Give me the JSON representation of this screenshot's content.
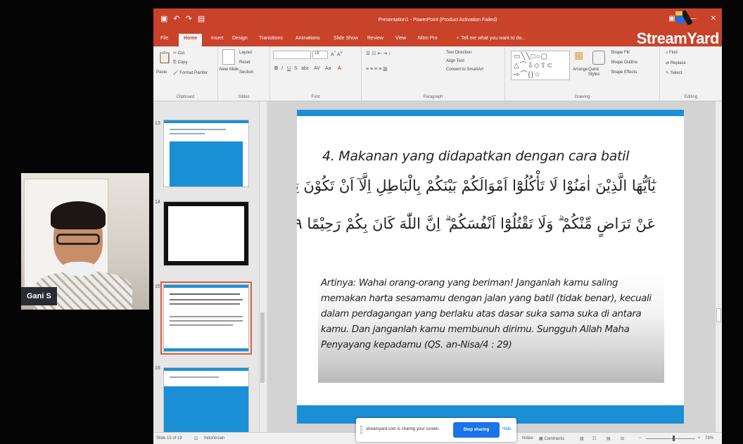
{
  "participant": {
    "name": "Gani S"
  },
  "window": {
    "title": "Presentation1 - PowerPoint (Product Activation Failed)",
    "qat_icons": [
      "save-icon",
      "undo-icon",
      "redo-icon",
      "present-icon"
    ]
  },
  "brand": {
    "streamyard": "StreamYard"
  },
  "ribbon": {
    "tabs": [
      "File",
      "Home",
      "Insert",
      "Design",
      "Transitions",
      "Animations",
      "Slide Show",
      "Review",
      "View",
      "Nitro Pro"
    ],
    "active_tab": "Home",
    "tell_me": "Tell me what you want to do...",
    "clipboard": {
      "paste": "Paste",
      "cut": "Cut",
      "copy": "Copy",
      "format_painter": "Format Painter",
      "label": "Clipboard"
    },
    "slides": {
      "new_slide": "New Slide",
      "layout": "Layout",
      "reset": "Reset",
      "section": "Section",
      "label": "Slides"
    },
    "font": {
      "size": "18",
      "label": "Font"
    },
    "paragraph": {
      "text_direction": "Text Direction",
      "align_text": "Align Text",
      "smartart": "Convert to SmartArt",
      "label": "Paragraph"
    },
    "drawing": {
      "arrange": "Arrange",
      "quick_styles": "Quick Styles",
      "shape_fill": "Shape Fill",
      "shape_outline": "Shape Outline",
      "shape_effects": "Shape Effects",
      "label": "Drawing"
    },
    "editing": {
      "find": "Find",
      "replace": "Replace",
      "select": "Select",
      "label": "Editing"
    }
  },
  "thumbnails": [
    {
      "number": "13"
    },
    {
      "number": "14"
    },
    {
      "number": "15"
    },
    {
      "number": "16"
    }
  ],
  "slide": {
    "title": "4. Makanan yang didapatkan dengan cara batil",
    "ayah_line1": "يٰٓاَيُّهَا الَّذِيْنَ اٰمَنُوْا لَا تَأْكُلُوْٓا اَمْوَالَكُمْ بَيْنَكُمْ بِالْبَاطِلِ اِلَّآ اَنْ تَكُوْنَ تِجَارَةً",
    "ayah_line2": "عَنْ تَرَاضٍ مِّنْكُمْ ۗ وَلَا تَقْتُلُوْٓا اَنْفُسَكُمْ ۗ اِنَّ اللّٰهَ كَانَ بِكُمْ رَحِيْمًا ۝٢٩",
    "translation": "Artinya: Wahai orang-orang yang beriman! Janganlah kamu saling memakan harta sesamamu dengan jalan yang batil (tidak benar), kecuali dalam perdagangan yang berlaku atas dasar suka sama suka di antara kamu. Dan janganlah kamu membunuh dirimu. Sungguh Allah Maha Penyayang kepadamu (QS. an-Nisa/4 : 29)"
  },
  "status": {
    "slide_counter": "Slide 15 of 19",
    "language": "Indonesian",
    "notes": "Notes",
    "comments": "Comments",
    "zoom": "73%"
  },
  "sharing": {
    "message": "streamyard.com is sharing your screen.",
    "stop": "Stop sharing",
    "hide": "Hide"
  },
  "colors": {
    "ppt_accent": "#c9422a",
    "slide_blue": "#1b8fd6",
    "share_blue": "#1a73e8"
  }
}
